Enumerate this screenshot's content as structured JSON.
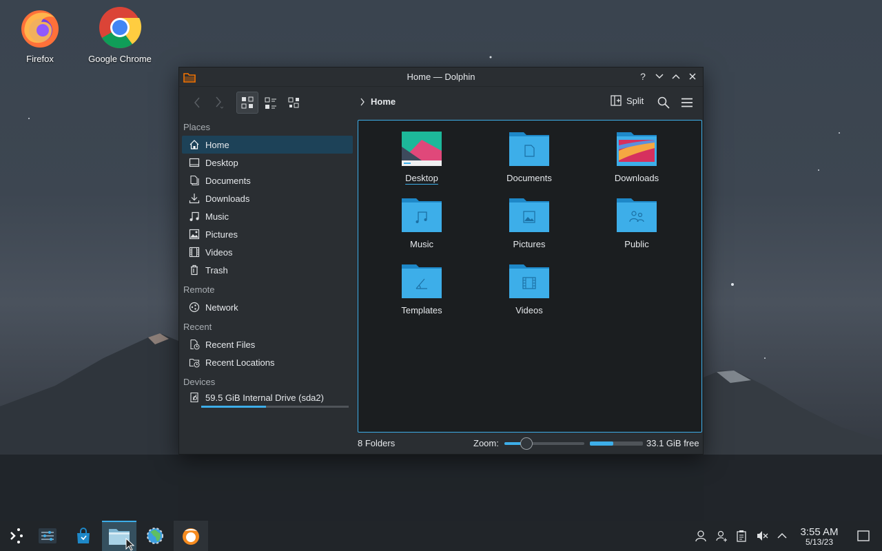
{
  "desktop": {
    "icons": [
      {
        "label": "Firefox"
      },
      {
        "label": "Google Chrome"
      }
    ]
  },
  "window": {
    "title": "Home — Dolphin",
    "breadcrumb": "Home",
    "split_label": "Split",
    "sidebar": {
      "places_title": "Places",
      "places": [
        {
          "label": "Home",
          "icon": "home-icon"
        },
        {
          "label": "Desktop",
          "icon": "desktop-icon"
        },
        {
          "label": "Documents",
          "icon": "documents-icon"
        },
        {
          "label": "Downloads",
          "icon": "downloads-icon"
        },
        {
          "label": "Music",
          "icon": "music-icon"
        },
        {
          "label": "Pictures",
          "icon": "pictures-icon"
        },
        {
          "label": "Videos",
          "icon": "videos-icon"
        },
        {
          "label": "Trash",
          "icon": "trash-icon"
        }
      ],
      "remote_title": "Remote",
      "remote": [
        {
          "label": "Network",
          "icon": "network-icon"
        }
      ],
      "recent_title": "Recent",
      "recent": [
        {
          "label": "Recent Files",
          "icon": "recent-files-icon"
        },
        {
          "label": "Recent Locations",
          "icon": "recent-locations-icon"
        }
      ],
      "devices_title": "Devices",
      "devices": [
        {
          "label": "59.5 GiB Internal Drive (sda2)",
          "icon": "drive-icon",
          "used_fraction": 0.44
        }
      ]
    },
    "files": [
      {
        "label": "Desktop",
        "icon": "desktop-folder-icon"
      },
      {
        "label": "Documents",
        "icon": "documents-folder-icon"
      },
      {
        "label": "Downloads",
        "icon": "downloads-folder-icon"
      },
      {
        "label": "Music",
        "icon": "music-folder-icon"
      },
      {
        "label": "Pictures",
        "icon": "pictures-folder-icon"
      },
      {
        "label": "Public",
        "icon": "public-folder-icon"
      },
      {
        "label": "Templates",
        "icon": "templates-folder-icon"
      },
      {
        "label": "Videos",
        "icon": "videos-folder-icon"
      }
    ],
    "status": {
      "folder_count": "8 Folders",
      "zoom_label": "Zoom:",
      "zoom_fraction": 0.28,
      "disk_used_fraction": 0.44,
      "free_space": "33.1 GiB free"
    }
  },
  "taskbar": {
    "time": "3:55 AM",
    "date": "5/13/23"
  },
  "colors": {
    "accent": "#3daee9",
    "folder": "#3daee9",
    "window_bg": "#2a2e32",
    "view_bg": "#1b1e20",
    "selection": "#1d4258"
  }
}
